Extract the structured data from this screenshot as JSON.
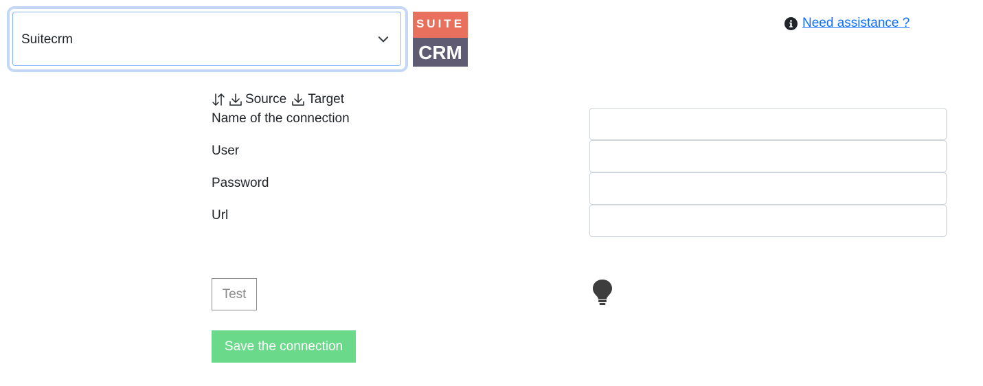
{
  "connector_select": {
    "value": "Suitecrm"
  },
  "logo": {
    "suite_text": "SUITE",
    "crm_text": "CRM",
    "colors": {
      "top": "#e8705d",
      "bottom": "#5f5b73"
    }
  },
  "help": {
    "icon": "info-circle-icon",
    "link_label": "Need assistance ?"
  },
  "direction": {
    "icons": [
      "swap-vertical-icon",
      "download-icon",
      "download-icon"
    ],
    "source_label": "Source",
    "target_label": "Target"
  },
  "form": {
    "fields": [
      {
        "label": "Name of the connection",
        "value": ""
      },
      {
        "label": "User",
        "value": ""
      },
      {
        "label": "Password",
        "value": ""
      },
      {
        "label": "Url",
        "value": ""
      }
    ]
  },
  "actions": {
    "test_label": "Test",
    "status_icon": "lightbulb-icon",
    "save_label": "Save the connection",
    "save_color": "#6bd98a"
  }
}
